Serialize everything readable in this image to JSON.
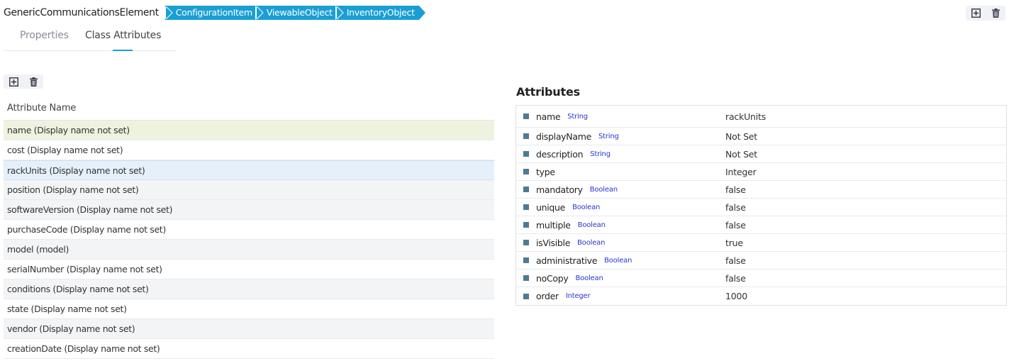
{
  "header": {
    "class_name": "GenericCommunicationsElement",
    "breadcrumbs": [
      "ConfigurationItem",
      "ViewableObject",
      "InventoryObject"
    ],
    "breadcrumb_color": "#1a9fd4"
  },
  "top_actions": {
    "add_icon": "plus-square-icon",
    "delete_icon": "trash-icon"
  },
  "tabs": [
    {
      "label": "Properties",
      "active": false
    },
    {
      "label": "Class Attributes",
      "active": true
    }
  ],
  "list_actions": {
    "add_icon": "plus-square-icon",
    "delete_icon": "trash-icon"
  },
  "attribute_list": {
    "header": "Attribute Name",
    "rows": [
      {
        "label": "name (Display name not set)",
        "state": "hover"
      },
      {
        "label": "cost (Display name not set)",
        "state": "normal"
      },
      {
        "label": "rackUnits (Display name not set)",
        "state": "selected"
      },
      {
        "label": "position (Display name not set)",
        "state": "alt"
      },
      {
        "label": "softwareVersion (Display name not set)",
        "state": "alt"
      },
      {
        "label": "purchaseCode (Display name not set)",
        "state": "normal"
      },
      {
        "label": "model (model)",
        "state": "alt"
      },
      {
        "label": "serialNumber (Display name not set)",
        "state": "normal"
      },
      {
        "label": "conditions (Display name not set)",
        "state": "alt"
      },
      {
        "label": "state (Display name not set)",
        "state": "normal"
      },
      {
        "label": "vendor (Display name not set)",
        "state": "alt"
      },
      {
        "label": "creationDate (Display name not set)",
        "state": "normal"
      }
    ]
  },
  "attributes_panel": {
    "title": "Attributes",
    "rows": [
      {
        "key": "name",
        "type": "String",
        "value": "rackUnits"
      },
      {
        "key": "displayName",
        "type": "String",
        "value": "Not Set"
      },
      {
        "key": "description",
        "type": "String",
        "value": "Not Set"
      },
      {
        "key": "type",
        "type": "",
        "value": "Integer"
      },
      {
        "key": "mandatory",
        "type": "Boolean",
        "value": "false"
      },
      {
        "key": "unique",
        "type": "Boolean",
        "value": "false"
      },
      {
        "key": "multiple",
        "type": "Boolean",
        "value": "false"
      },
      {
        "key": "isVisible",
        "type": "Boolean",
        "value": "true"
      },
      {
        "key": "administrative",
        "type": "Boolean",
        "value": "false"
      },
      {
        "key": "noCopy",
        "type": "Boolean",
        "value": "false"
      },
      {
        "key": "order",
        "type": "Integer",
        "value": "1000"
      }
    ]
  }
}
